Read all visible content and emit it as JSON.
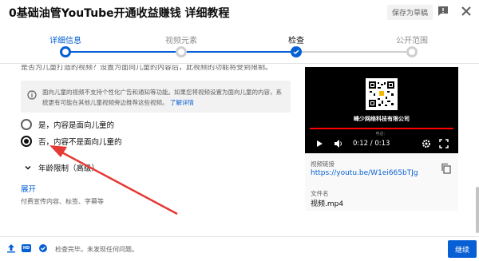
{
  "header": {
    "title": "0基础油管YouTube开通收益赚钱 详细教程",
    "save_draft": "保存为草稿"
  },
  "stepper": {
    "steps": [
      {
        "label": "详细信息",
        "state": "active"
      },
      {
        "label": "视频元素",
        "state": "pending"
      },
      {
        "label": "检查",
        "state": "done"
      },
      {
        "label": "公开范围",
        "state": "pending"
      }
    ]
  },
  "audience": {
    "cut_text": "是否为儿童打造的视频？设置为面向儿童的内容后，此视频的功能将受到限制。",
    "info_text": "面向儿童的视频不支持个性化广告和通知等功能。如果您将视频设置为面向儿童的内容，系统更有可能在其他儿童视频旁边推荐这些视频。",
    "info_link": "了解详情",
    "option_yes": "是，内容是面向儿童的",
    "option_no": "否，内容不是面向儿童的",
    "age_restriction": "年龄限制（高级）",
    "expand": "展开",
    "expand_sub": "付费宣传内容、标签、字幕等"
  },
  "video": {
    "company": "峰少网络科技有限公司",
    "small_text": "电话：",
    "time": "0:12 / 0:13",
    "link_label": "视频链接",
    "link": "https://youtu.be/W1ei665bTJg",
    "file_label": "文件名",
    "file_name": "视频.mp4"
  },
  "footer": {
    "status": "检查完毕。未发现任何问题。",
    "next": "继续",
    "hd_badge": "HD"
  },
  "colors": {
    "accent": "#065fd4",
    "annotation_arrow": "#e53935"
  }
}
